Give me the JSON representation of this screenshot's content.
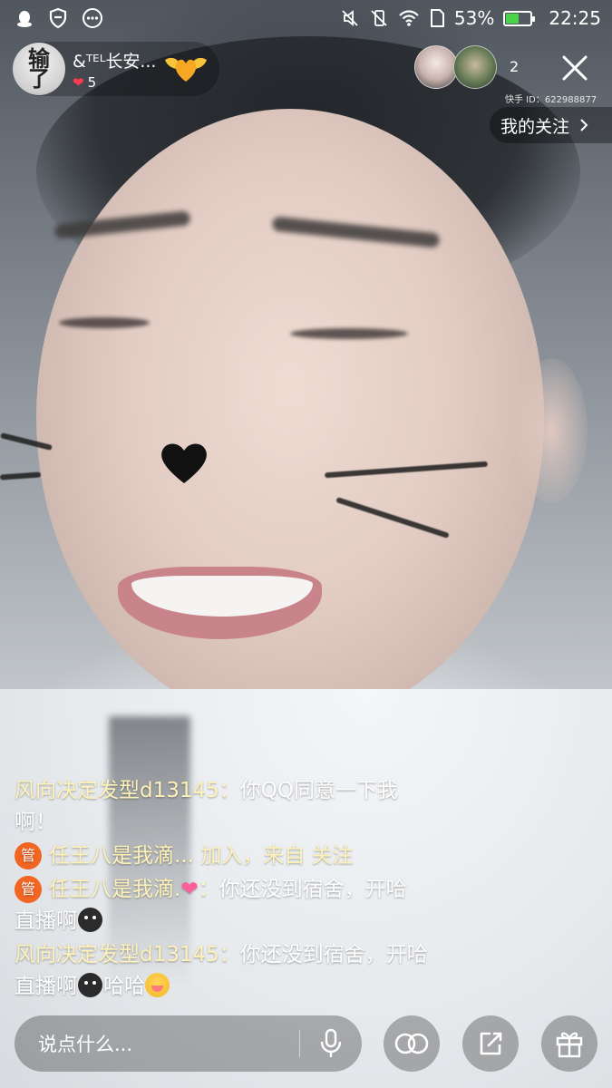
{
  "status_bar": {
    "battery_percent": "53%",
    "battery_level": 0.53,
    "time": "22:25",
    "icons_left": [
      "qq-icon",
      "shield-icon",
      "more-dots-icon"
    ],
    "icons_right": [
      "mute-icon",
      "vibrate-off-icon",
      "wifi-icon",
      "sim-icon",
      "battery-icon"
    ]
  },
  "host": {
    "avatar_text_1": "输",
    "avatar_text_2": "了",
    "name": "&ᵀᴱᴸ长安...",
    "likes": "5",
    "follow_icon": "winged-heart-icon"
  },
  "viewers": {
    "count": "2",
    "user_id": "快手 ID：622988877"
  },
  "my_follow": {
    "label": "我的关注"
  },
  "comments": [
    {
      "user": "风向决定发型d13145：",
      "text_1": "你QQ同意一下我",
      "text_2": "啊！"
    },
    {
      "badge": "管",
      "user": "任王八是我滴...",
      "text": " 加入，来自 关注"
    },
    {
      "badge": "管",
      "user": "任王八是我滴.",
      "heart": "❤",
      "user_suffix": "：",
      "text_1": "你还没到宿舍，开哈",
      "text_2": "直播啊"
    },
    {
      "user": "风向决定发型d13145：",
      "text_1": "你还没到宿舍，开哈",
      "text_2": "直播啊",
      "text_3": "哈哈"
    }
  ],
  "bottom_bar": {
    "input_placeholder": "说点什么...",
    "buttons": [
      "mic-icon",
      "link-icon",
      "share-icon",
      "gift-icon"
    ]
  },
  "colors": {
    "comment_user": "#fff2b8",
    "admin_badge": "#f26522",
    "battery": "#4ad24a",
    "like_heart": "#ff3b4e"
  }
}
